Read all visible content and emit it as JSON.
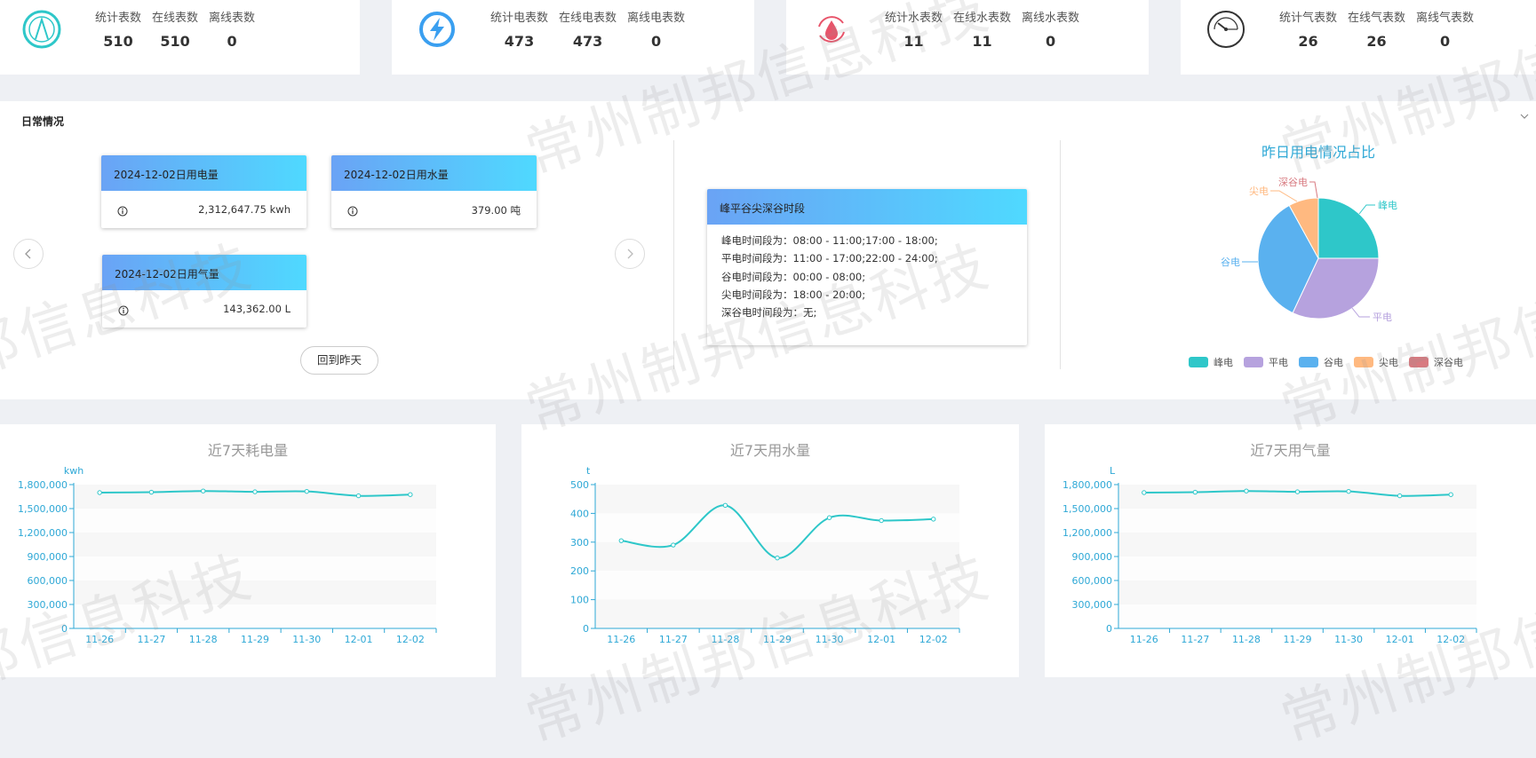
{
  "stats": [
    {
      "labels": [
        "统计表数",
        "在线表数",
        "离线表数"
      ],
      "values": [
        "510",
        "510",
        "0"
      ],
      "icon": "meter-gauge-icon"
    },
    {
      "labels": [
        "统计电表数",
        "在线电表数",
        "离线电表数"
      ],
      "values": [
        "473",
        "473",
        "0"
      ],
      "icon": "lightning-icon"
    },
    {
      "labels": [
        "统计水表数",
        "在线水表数",
        "离线水表数"
      ],
      "values": [
        "11",
        "11",
        "0"
      ],
      "icon": "water-drop-icon"
    },
    {
      "labels": [
        "统计气表数",
        "在线气表数",
        "离线气表数"
      ],
      "values": [
        "26",
        "26",
        "0"
      ],
      "icon": "gas-gauge-icon"
    }
  ],
  "daily": {
    "title": "日常情况",
    "electric": {
      "title": "2024-12-02日用电量",
      "value": "2,312,647.75 kwh"
    },
    "water": {
      "title": "2024-12-02日用水量",
      "value": "379.00 吨"
    },
    "gas": {
      "title": "2024-12-02日用气量",
      "value": "143,362.00 L"
    },
    "back_label": "回到昨天",
    "period": {
      "title": "峰平谷尖深谷时段",
      "lines": [
        "峰电时间段为：08:00 - 11:00;17:00 - 18:00;",
        "平电时间段为：11:00 - 17:00;22:00 - 24:00;",
        "谷电时间段为：00:00 - 08:00;",
        "尖电时间段为：18:00 - 20:00;",
        "深谷电时间段为：无;"
      ]
    },
    "pie": {
      "title": "昨日用电情况占比",
      "slices": [
        {
          "name": "峰电",
          "value": 25,
          "color": "#2ec7c9"
        },
        {
          "name": "平电",
          "value": 32,
          "color": "#b6a2de"
        },
        {
          "name": "谷电",
          "value": 35,
          "color": "#5ab1ef"
        },
        {
          "name": "尖电",
          "value": 8,
          "color": "#ffb980"
        },
        {
          "name": "深谷电",
          "value": 0,
          "color": "#d87a80"
        }
      ]
    }
  },
  "chart_data": [
    {
      "type": "line",
      "title": "近7天耗电量",
      "ylabel": "kwh",
      "x": [
        "11-26",
        "11-27",
        "11-28",
        "11-29",
        "11-30",
        "12-01",
        "12-02"
      ],
      "values": [
        1700000,
        1705000,
        1720000,
        1710000,
        1715000,
        1660000,
        1675000
      ],
      "ylim": [
        0,
        1800000
      ],
      "yticks": [
        "0",
        "300,000",
        "600,000",
        "900,000",
        "1,200,000",
        "1,500,000",
        "1,800,000"
      ],
      "color": "#2ec7c9"
    },
    {
      "type": "line",
      "title": "近7天用水量",
      "ylabel": "t",
      "x": [
        "11-26",
        "11-27",
        "11-28",
        "11-29",
        "11-30",
        "12-01",
        "12-02"
      ],
      "values": [
        305,
        290,
        428,
        245,
        385,
        375,
        380
      ],
      "ylim": [
        0,
        500
      ],
      "yticks": [
        "0",
        "100",
        "200",
        "300",
        "400",
        "500"
      ],
      "color": "#2ec7c9"
    },
    {
      "type": "line",
      "title": "近7天用气量",
      "ylabel": "L",
      "x": [
        "11-26",
        "11-27",
        "11-28",
        "11-29",
        "11-30",
        "12-01",
        "12-02"
      ],
      "values": [
        1700000,
        1705000,
        1720000,
        1710000,
        1715000,
        1660000,
        1675000
      ],
      "ylim": [
        0,
        1800000
      ],
      "yticks": [
        "0",
        "300,000",
        "600,000",
        "900,000",
        "1,200,000",
        "1,500,000",
        "1,800,000"
      ],
      "color": "#2ec7c9"
    }
  ],
  "watermark": "常州制邦信息科技"
}
